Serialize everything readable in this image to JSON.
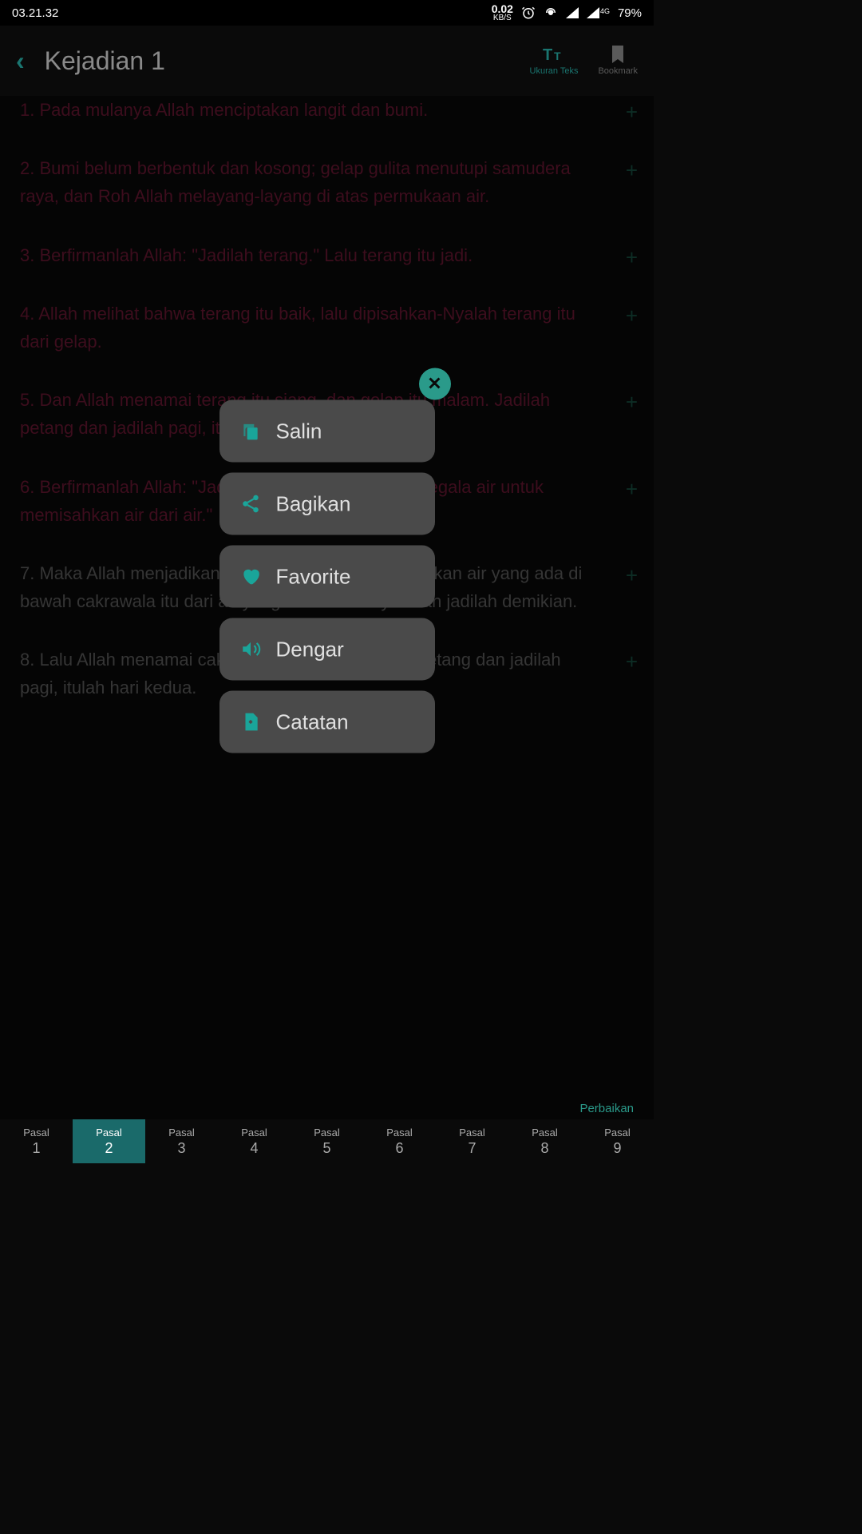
{
  "status_bar": {
    "time": "03.21.32",
    "speed_val": "0.02",
    "speed_unit": "KB/S",
    "network": "4G",
    "battery": "79%"
  },
  "header": {
    "title": "Kejadian 1",
    "text_size_label": "Ukuran Teks",
    "bookmark_label": "Bookmark"
  },
  "verses": [
    {
      "text": "1. Pada mulanya Allah menciptakan langit dan bumi.",
      "gray": false
    },
    {
      "text": "2. Bumi belum berbentuk dan kosong; gelap gulita menutupi samudera raya, dan Roh Allah melayang-layang di atas permukaan air.",
      "gray": false
    },
    {
      "text": "3. Berfirmanlah Allah: \"Jadilah terang.\" Lalu terang itu jadi.",
      "gray": false
    },
    {
      "text": "4. Allah melihat bahwa terang itu baik, lalu dipisahkan-Nyalah terang itu dari gelap.",
      "gray": false
    },
    {
      "text": "5. Dan Allah menamai terang itu siang, dan gelap itu malam. Jadilah petang dan jadilah pagi, itulah hari pertama.",
      "gray": false
    },
    {
      "text": "6. Berfirmanlah Allah: \"Jadilah cakrawala di tengah segala air untuk memisahkan air dari air.\"",
      "gray": false
    },
    {
      "text": "7. Maka Allah menjadikan cakrawala dan Ia memisahkan air yang ada di bawah cakrawala itu dari air yang ada di atasnya. Dan jadilah demikian.",
      "gray": true
    },
    {
      "text": "8. Lalu Allah menamai cakrawala itu langit. Jadilah petang dan jadilah pagi, itulah hari kedua.",
      "gray": true
    }
  ],
  "fix_label": "Perbaikan",
  "tabs": {
    "label": "Pasal",
    "numbers": [
      "1",
      "2",
      "3",
      "4",
      "5",
      "6",
      "7",
      "8",
      "9"
    ],
    "active": 1
  },
  "menu": {
    "items": [
      {
        "label": "Salin",
        "icon": "copy"
      },
      {
        "label": "Bagikan",
        "icon": "share"
      },
      {
        "label": "Favorite",
        "icon": "heart"
      },
      {
        "label": "Dengar",
        "icon": "volume"
      },
      {
        "label": "Catatan",
        "icon": "note"
      }
    ]
  }
}
